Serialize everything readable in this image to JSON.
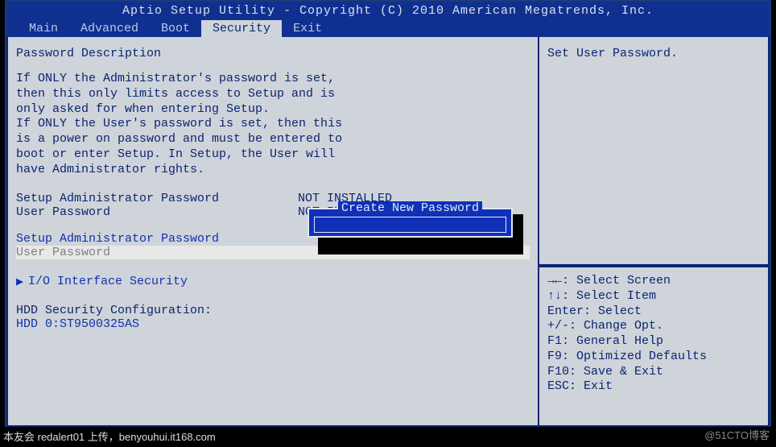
{
  "header": {
    "title": "Aptio Setup Utility - Copyright (C) 2010 American Megatrends, Inc."
  },
  "tabs": {
    "items": [
      "Main",
      "Advanced",
      "Boot",
      "Security",
      "Exit"
    ],
    "active_index": 3
  },
  "left": {
    "desc_head": "Password Description",
    "desc_body": "If ONLY the Administrator's password is set,\nthen this only limits access to Setup and is\nonly asked for when entering Setup.\nIf ONLY the User's password is set, then this\nis a power on password and must be entered to\nboot or enter Setup. In Setup, the User will\nhave Administrator rights.",
    "status": [
      {
        "label": "Setup Administrator Password",
        "value": "NOT INSTALLED"
      },
      {
        "label": "User Password",
        "value": "NOT INSTALLED"
      }
    ],
    "menu_set_admin": "Setup Administrator Password",
    "menu_user_pw": "User Password",
    "submenu_io": "I/O Interface Security",
    "hdd_head": "HDD Security Configuration:",
    "hdd_item": "HDD 0:ST9500325AS"
  },
  "popup": {
    "title": "Create New Password",
    "value": ""
  },
  "right": {
    "help_title": "Set User Password.",
    "keys": [
      "→←: Select Screen",
      "↑↓: Select Item",
      "Enter: Select",
      "+/-: Change Opt.",
      "F1: General Help",
      "F9: Optimized Defaults",
      "F10: Save & Exit",
      "ESC: Exit"
    ]
  },
  "caption": "本友会 redalert01 上传，benyouhui.it168.com",
  "watermark": "@51CTO博客"
}
